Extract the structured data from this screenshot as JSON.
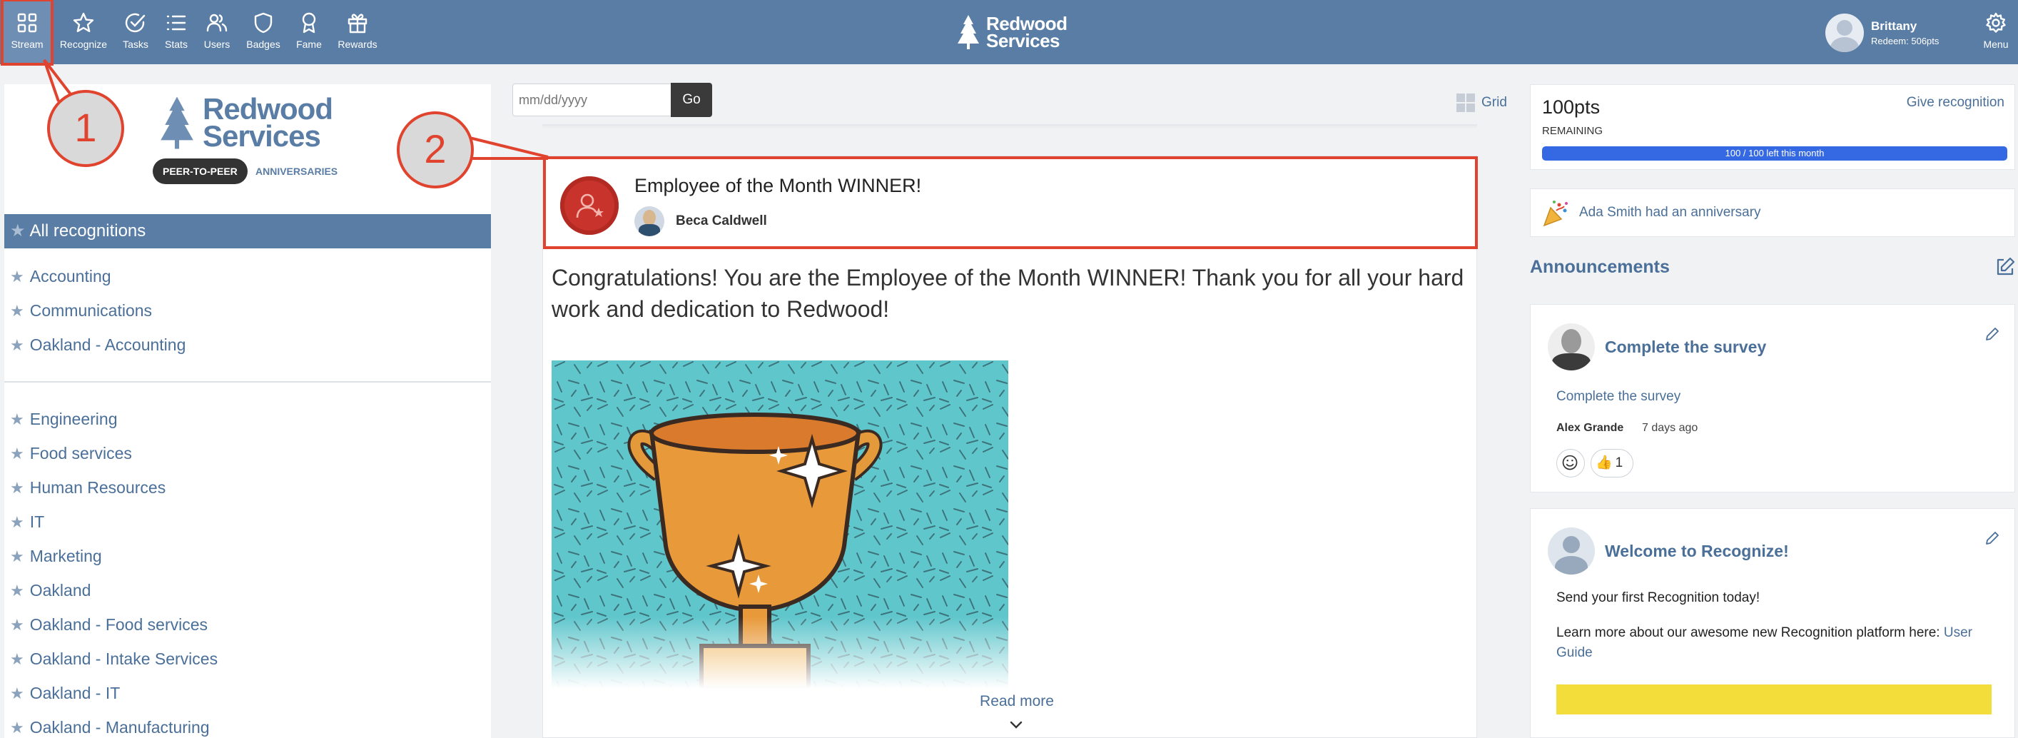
{
  "nav": {
    "items": [
      {
        "label": "Stream",
        "icon": "stream-icon"
      },
      {
        "label": "Recognize",
        "icon": "star-icon"
      },
      {
        "label": "Tasks",
        "icon": "check-circle-icon"
      },
      {
        "label": "Stats",
        "icon": "list-icon"
      },
      {
        "label": "Users",
        "icon": "users-icon"
      },
      {
        "label": "Badges",
        "icon": "shield-icon"
      },
      {
        "label": "Fame",
        "icon": "ribbon-icon"
      },
      {
        "label": "Rewards",
        "icon": "gift-icon"
      }
    ],
    "active": "Stream",
    "brand_line1": "Redwood",
    "brand_line2": "Services",
    "user_name": "Brittany",
    "user_points": "Redeem: 506pts",
    "menu_label": "Menu"
  },
  "colors": {
    "header_bg": "#5a7da5",
    "accent": "#e0442e",
    "link": "#4a6f98",
    "progress": "#3569e3"
  },
  "callouts": {
    "one": "1",
    "two": "2"
  },
  "sidebar": {
    "brand_line1": "Redwood",
    "brand_line2": "Services",
    "tab_active": "PEER-TO-PEER",
    "tab_other": "ANNIVERSARIES",
    "all_label": "All recognitions",
    "group1": [
      "Accounting",
      "Communications",
      "Oakland - Accounting"
    ],
    "group2": [
      "Engineering",
      "Food services",
      "Human Resources",
      "IT",
      "Marketing",
      "Oakland",
      "Oakland - Food services",
      "Oakland - Intake Services",
      "Oakland - IT",
      "Oakland - Manufacturing"
    ]
  },
  "stream": {
    "date_placeholder": "mm/dd/yyyy",
    "go_label": "Go",
    "grid_label": "Grid",
    "card": {
      "title": "Employee of the Month WINNER!",
      "author": "Beca Caldwell",
      "message": "Congratulations! You are the Employee of the Month WINNER! Thank you for all your hard work and dedication to Redwood!",
      "read_more": "Read more"
    }
  },
  "right": {
    "points": "100pts",
    "remaining_label": "REMAINING",
    "give_label": "Give recognition",
    "progress_text": "100 / 100 left this month",
    "progress_fraction": 1.0,
    "anniversary_text": "Ada Smith had an anniversary",
    "announcements_heading": "Announcements",
    "ann1": {
      "title": "Complete the survey",
      "link": "Complete the survey",
      "author": "Alex Grande",
      "time": "7 days ago",
      "thumbs_count": "1"
    },
    "ann2": {
      "title": "Welcome to Recognize!",
      "p1": "Send your first Recognition today!",
      "p2": "Learn more about our awesome new Recognition platform here:",
      "p2_link": "User Guide"
    }
  }
}
